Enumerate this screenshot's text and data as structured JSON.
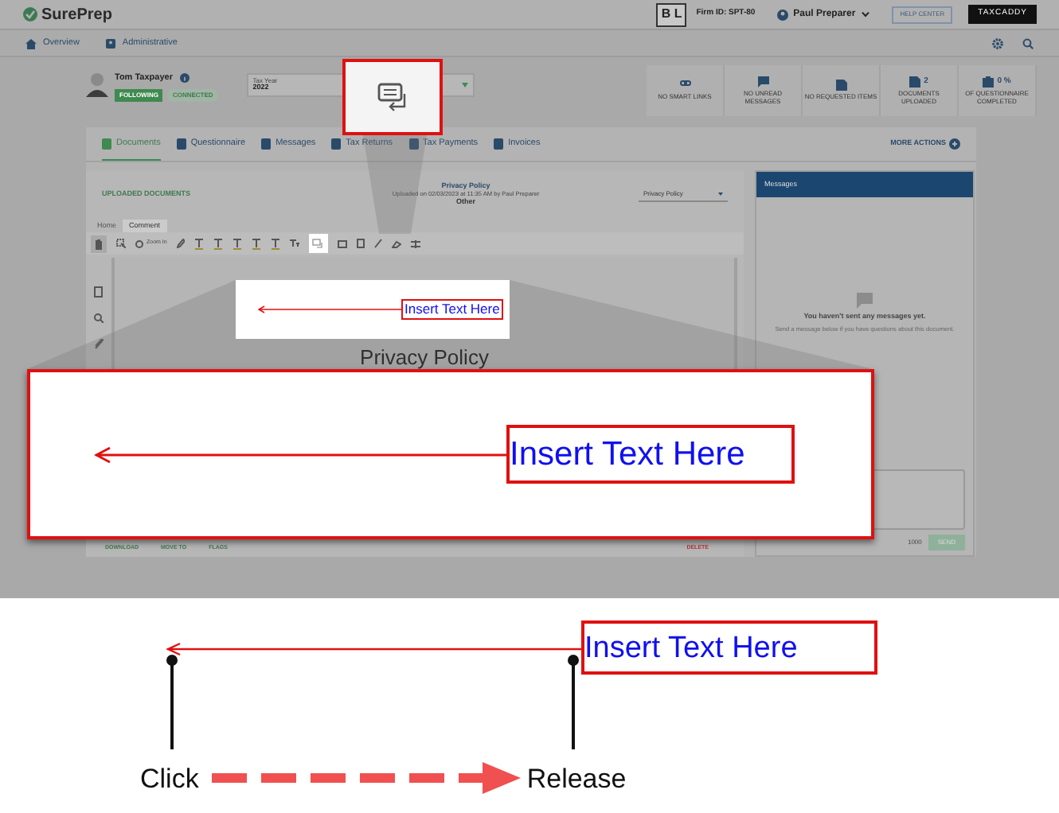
{
  "header": {
    "logo": "SurePrep",
    "firm_badge": "B L",
    "firm_id": "Firm ID: SPT-80",
    "user": "Paul Preparer",
    "help": "HELP CENTER",
    "product": "TAXCADDY"
  },
  "nav": [
    {
      "label": "Overview"
    },
    {
      "label": "Administrative"
    }
  ],
  "client": {
    "name": "Tom Taxpayer",
    "following": "FOLLOWING",
    "connected": "CONNECTED",
    "tax_year_label": "Tax Year",
    "tax_year": "2022"
  },
  "stats": [
    {
      "label": "NO SMART LINKS"
    },
    {
      "label": "NO UNREAD MESSAGES"
    },
    {
      "label": "NO REQUESTED ITEMS"
    },
    {
      "count": "2",
      "label": "DOCUMENTS UPLOADED"
    },
    {
      "count": "0 %",
      "label": "OF QUESTIONNAIRE COMPLETED"
    }
  ],
  "tabs": [
    {
      "label": "Documents",
      "selected": true
    },
    {
      "label": "Questionnaire",
      "selected": false
    },
    {
      "label": "Messages",
      "selected": false
    },
    {
      "label": "Tax Returns",
      "selected": false
    },
    {
      "label": "Tax Payments",
      "selected": false
    },
    {
      "label": "Invoices",
      "selected": false
    }
  ],
  "more_actions": "MORE ACTIONS",
  "document": {
    "back": "UPLOADED DOCUMENTS",
    "title": "Privacy Policy",
    "uploaded": "Uploaded on 02/03/2023 at 11:35 AM by Paul Preparer",
    "category": "Other",
    "dropdown": "Privacy Policy",
    "ribbon_tabs": [
      {
        "label": "Home",
        "selected": false
      },
      {
        "label": "Comment",
        "selected": true
      }
    ],
    "zoom": "Zoom In",
    "page_heading": "Privacy Policy",
    "footer_actions": [
      "DOWNLOAD",
      "MOVE TO",
      "FLAGS"
    ],
    "delete": "DELETE"
  },
  "messages": {
    "title": "Messages",
    "empty": "You haven't sent any messages yet.",
    "hint": "Send a message below if you have questions about this document.",
    "count": "1000",
    "send": "SEND"
  },
  "callouts": {
    "small_text": "Insert Text Here",
    "large_text": "Insert Text Here"
  },
  "diagram": {
    "text": "Insert Text Here",
    "click": "Click",
    "release": "Release"
  }
}
